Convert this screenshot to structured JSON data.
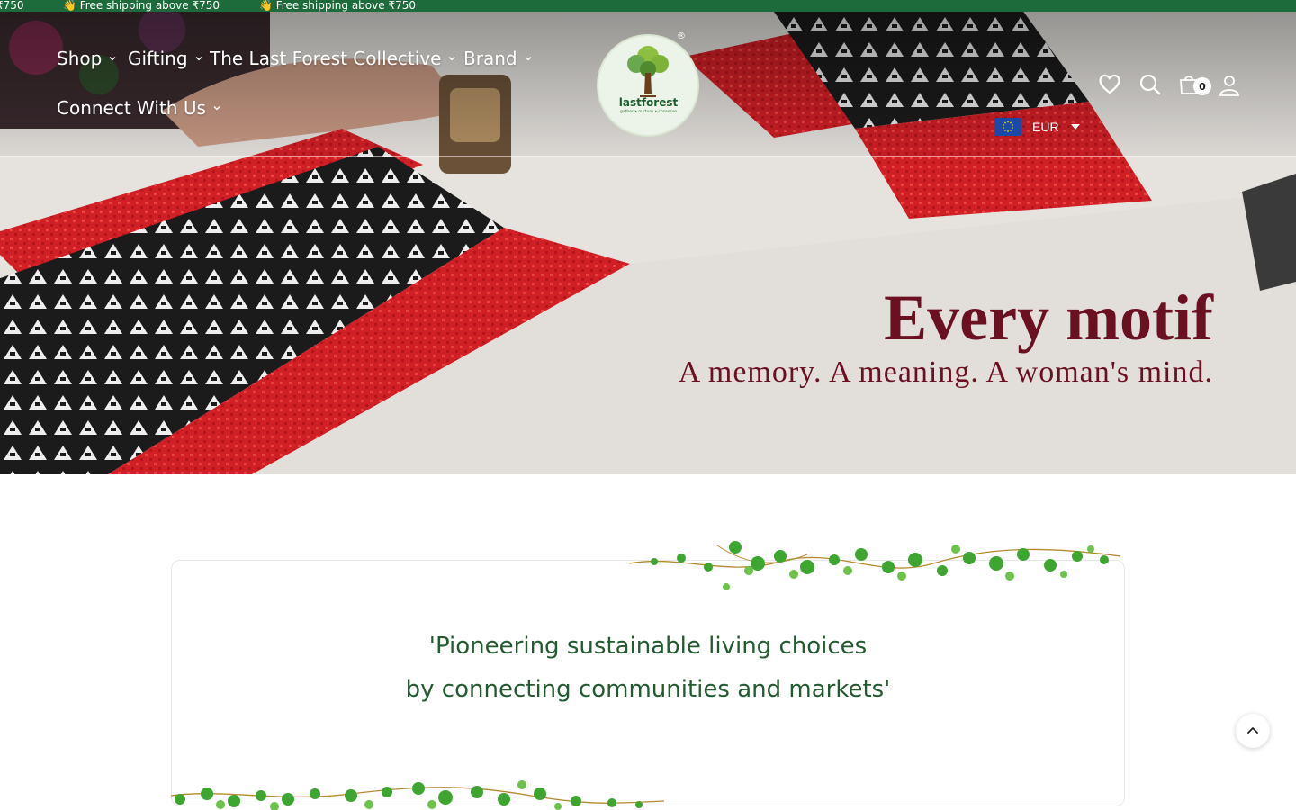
{
  "announcement": {
    "messages": [
      "₹750",
      "👋 Free shipping above ₹750",
      "👋 Free shipping above ₹750"
    ]
  },
  "nav": {
    "items": [
      {
        "label": "Shop",
        "icon": "chevron-down-icon"
      },
      {
        "label": "Gifting",
        "icon": "chevron-down-icon"
      },
      {
        "label": "The Last Forest Collective",
        "icon": "chevron-down-icon"
      },
      {
        "label": "Brand",
        "icon": "chevron-down-icon"
      },
      {
        "label": "Connect With Us",
        "icon": "chevron-down-icon"
      }
    ]
  },
  "brand": {
    "logo_name": "lastforest",
    "logo_tagline": "gather • nurture • conserve",
    "registered_mark": "®"
  },
  "header_actions": {
    "wishlist_icon": "heart-icon",
    "search_icon": "search-icon",
    "cart_icon": "shopping-bag-icon",
    "cart_count": "0",
    "account_icon": "user-icon"
  },
  "currency": {
    "flag": "eu-flag-icon",
    "code": "EUR"
  },
  "hero": {
    "headline": "Every motif",
    "subline": "A memory. A meaning. A woman's mind."
  },
  "mission": {
    "line1": "'Pioneering sustainable living choices",
    "line2": "by connecting communities and markets'"
  },
  "colors": {
    "announcement_bg": "#1d6b3a",
    "hero_text": "#6b1020",
    "mission_text": "#235a2f"
  }
}
